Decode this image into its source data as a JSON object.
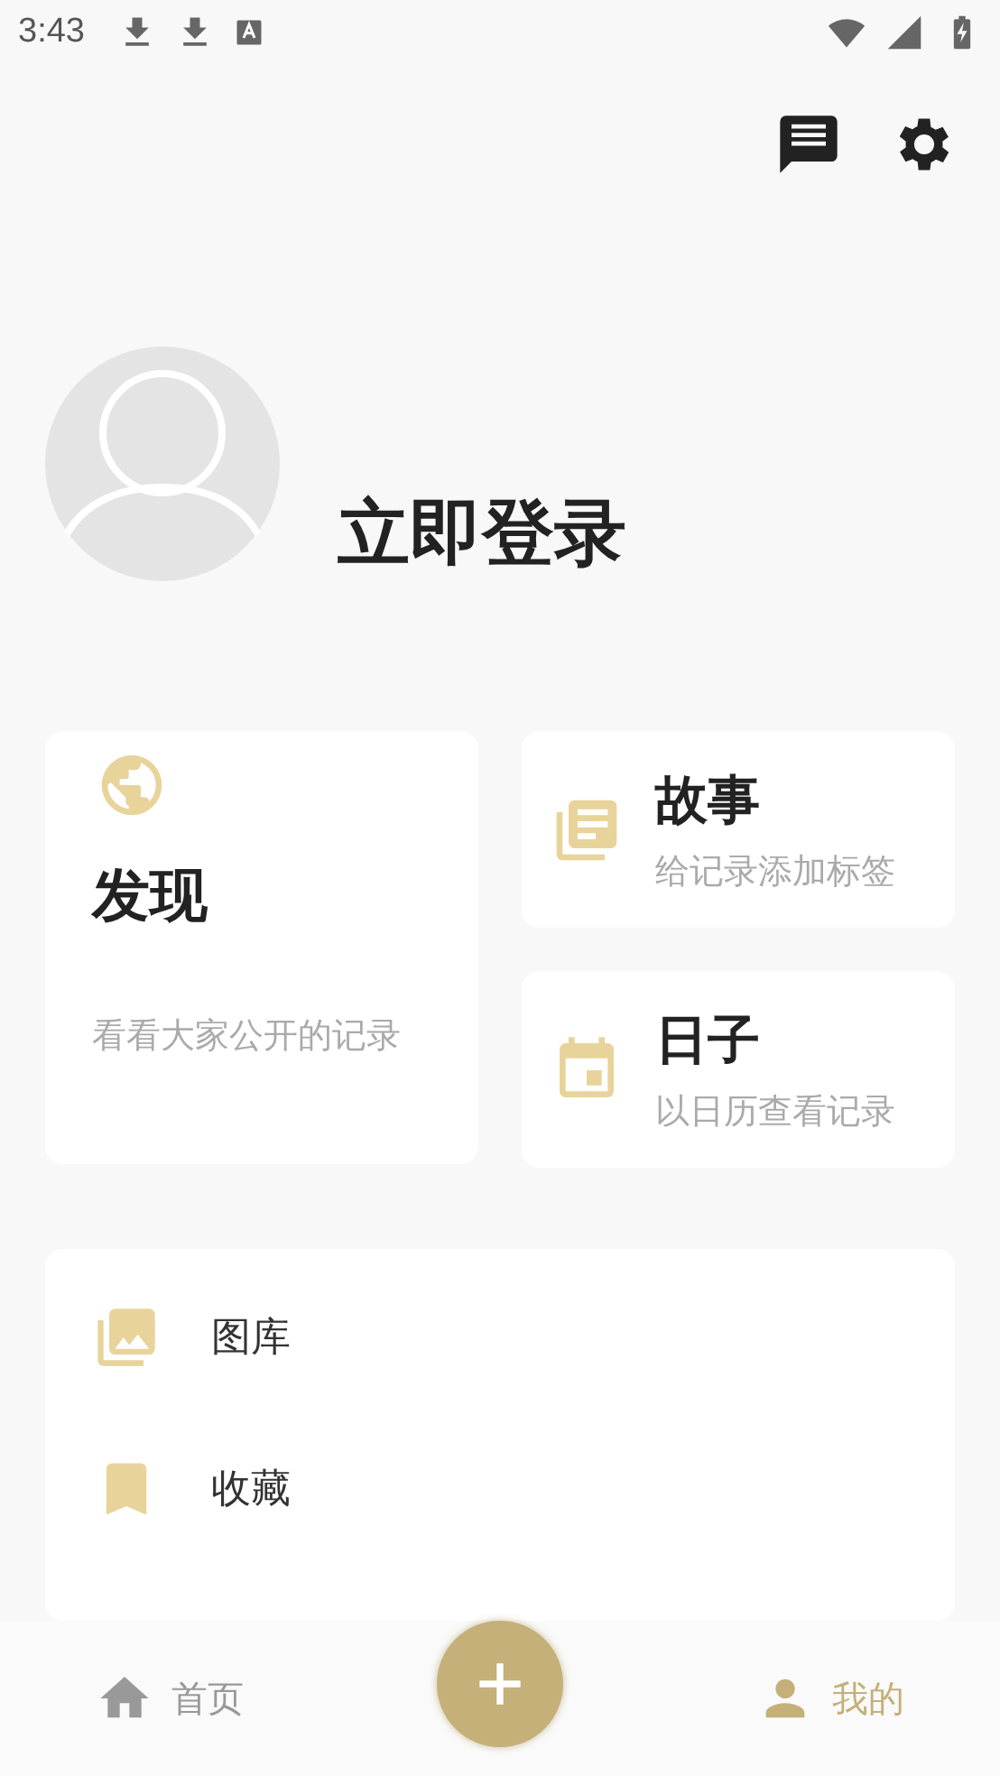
{
  "status_bar": {
    "time": "3:43"
  },
  "profile": {
    "login_label": "立即登录"
  },
  "features": [
    {
      "kind": "globe",
      "title": "发现",
      "subtitle": "看看大家公开的记录"
    },
    {
      "kind": "library",
      "title": "故事",
      "subtitle": "给记录添加标签"
    },
    {
      "kind": "calendar",
      "title": "日子",
      "subtitle": "以日历查看记录"
    }
  ],
  "menu": [
    {
      "kind": "photos",
      "label": "图库"
    },
    {
      "kind": "bookmark",
      "label": "收藏"
    }
  ],
  "bottom_nav": [
    {
      "kind": "home",
      "label": "首页",
      "selected": false
    },
    {
      "kind": "person",
      "label": "我的",
      "selected": true
    }
  ]
}
